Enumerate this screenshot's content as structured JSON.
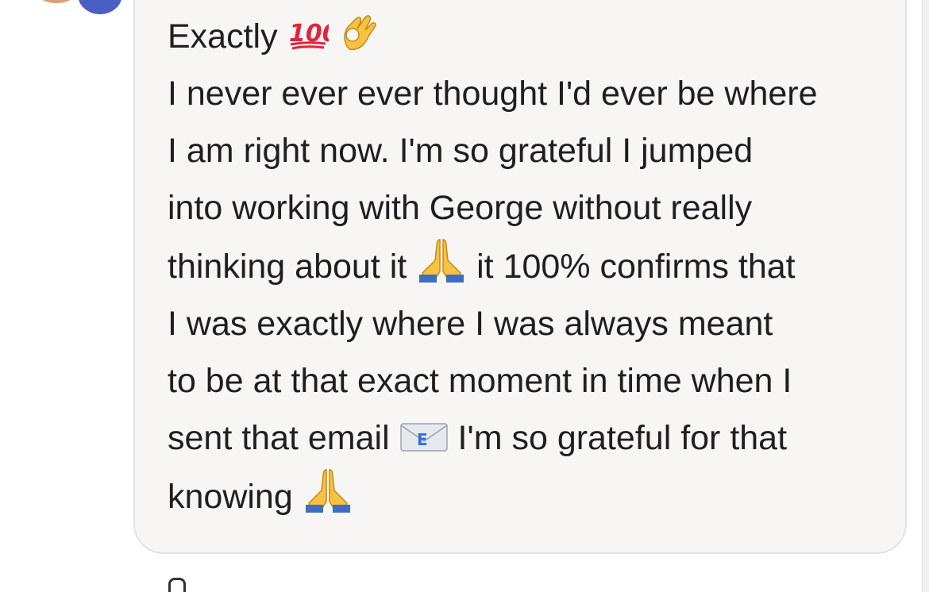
{
  "comment": {
    "lines": [
      {
        "pre": "Exactly ",
        "emoji": [
          "hundred-points-icon",
          "ok-hand-icon"
        ],
        "post": ""
      },
      {
        "pre": "I never ever ever thought I'd ever be where",
        "post": ""
      },
      {
        "pre": "I am right now. I'm so grateful I jumped",
        "post": ""
      },
      {
        "pre": "into working with George without really",
        "post": ""
      },
      {
        "pre": "thinking about it ",
        "emoji": [
          "praying-hands-icon"
        ],
        "post": " it 100% confirms that"
      },
      {
        "pre": "I was exactly where I was always meant",
        "post": ""
      },
      {
        "pre": "to be at that exact moment in time when I",
        "post": ""
      },
      {
        "pre": "sent that email ",
        "emoji": [
          "email-icon"
        ],
        "post": " I'm so grateful for that"
      },
      {
        "pre": "knowing ",
        "emoji": [
          "praying-hands-icon"
        ],
        "post": ""
      }
    ]
  },
  "colors": {
    "bubble_bg": "#f7f6f5",
    "bubble_border": "#e3e3e3",
    "text": "#1f1f1f",
    "avatar_blue": "#4a5fc1"
  }
}
